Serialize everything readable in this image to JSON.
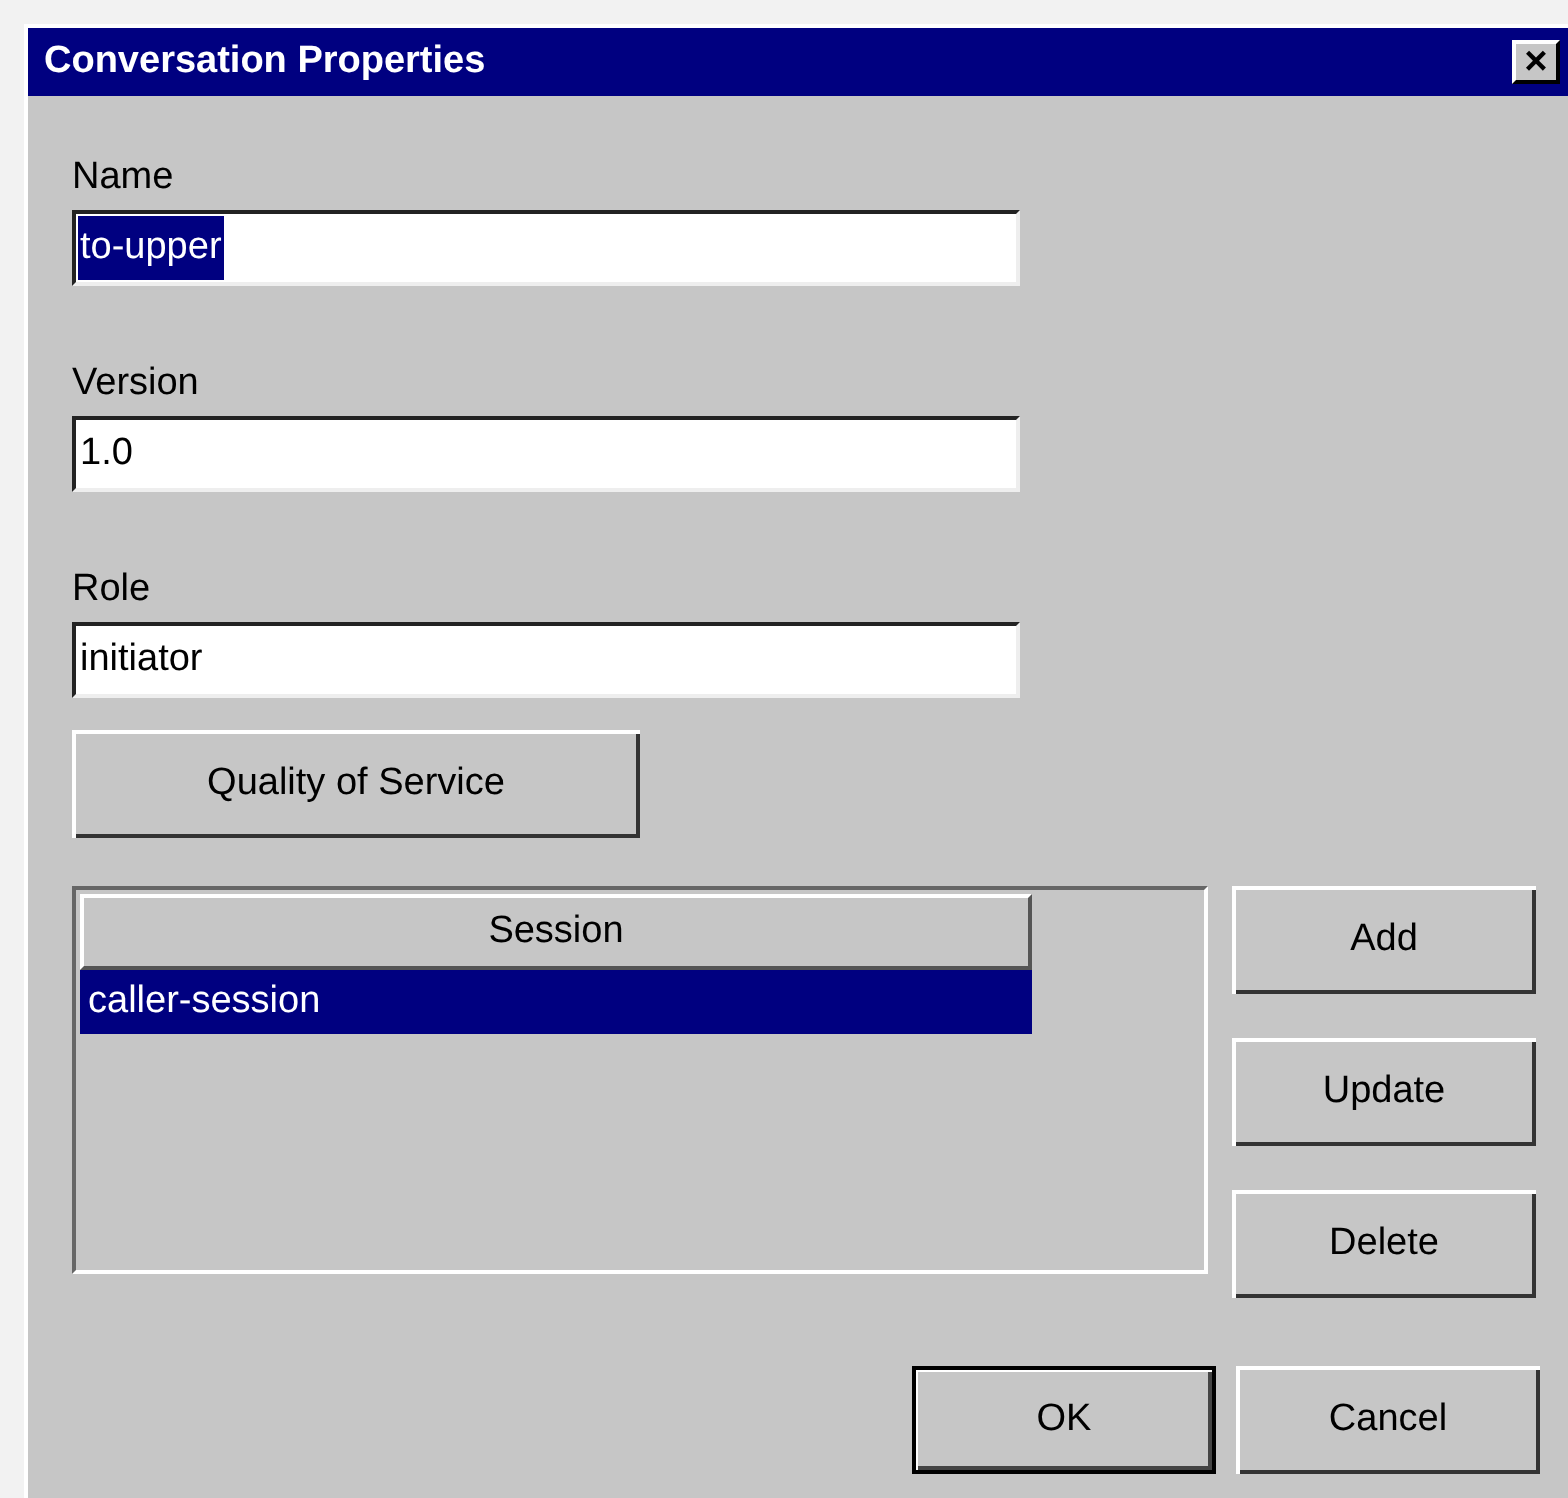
{
  "window": {
    "title": "Conversation Properties",
    "close": "×"
  },
  "fields": [
    {
      "label": "Name",
      "value": "to-upper",
      "text_selected": true
    },
    {
      "label": "Version",
      "value": "1.0",
      "text_selected": false
    },
    {
      "label": "Role",
      "value": "initiator",
      "text_selected": false
    }
  ],
  "qos_button": "Quality of Service",
  "table": {
    "columns": [
      "Session"
    ],
    "rows": [
      {
        "cells": [
          "caller-session"
        ],
        "selected": true
      }
    ]
  },
  "side_buttons": [
    "Add",
    "Update",
    "Delete"
  ],
  "buttons": [
    {
      "label": "OK",
      "default": true
    },
    {
      "label": "Cancel",
      "default": false
    }
  ]
}
